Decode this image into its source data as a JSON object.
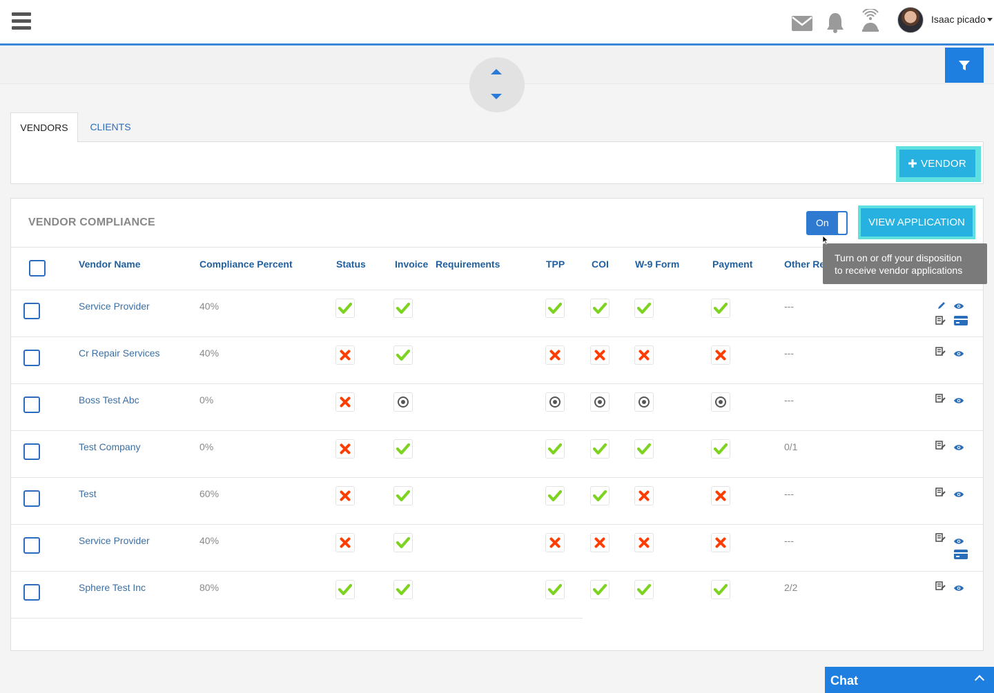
{
  "header": {
    "user_name": "Isaac picado",
    "icons": [
      "menu-icon",
      "mail-icon",
      "bell-icon",
      "broadcast-icon"
    ]
  },
  "tabs": [
    {
      "label": "VENDORS",
      "active": true
    },
    {
      "label": "CLIENTS",
      "active": false
    }
  ],
  "vendor_panel": {
    "add_button_label": "VENDOR"
  },
  "compliance": {
    "title": "VENDOR COMPLIANCE",
    "toggle_label": "On",
    "view_application_label": "VIEW APPLICATION",
    "tooltip_line1": "Turn on or off your disposition",
    "tooltip_line2": "to receive vendor applications",
    "columns": {
      "vendor_name": "Vendor Name",
      "compliance_percent": "Compliance Percent",
      "status": "Status",
      "invoice": "Invoice",
      "requirements": "Requirements",
      "tpp": "TPP",
      "coi": "COI",
      "w9": "W-9 Form",
      "payment": "Payment",
      "other": "Other Re"
    },
    "rows": [
      {
        "name": "Service Provider",
        "percent": "40%",
        "status": "check",
        "invoice": "check",
        "tpp": "check",
        "coi": "check",
        "w9": "check",
        "payment": "check",
        "other": "---"
      },
      {
        "name": "Cr Repair Services",
        "percent": "40%",
        "status": "cross",
        "invoice": "check",
        "tpp": "cross",
        "coi": "cross",
        "w9": "cross",
        "payment": "cross",
        "other": "---"
      },
      {
        "name": "Boss Test Abc",
        "percent": "0%",
        "status": "cross",
        "invoice": "pending",
        "tpp": "pending",
        "coi": "pending",
        "w9": "pending",
        "payment": "pending",
        "other": "---"
      },
      {
        "name": "Test Company",
        "percent": "0%",
        "status": "cross",
        "invoice": "check",
        "tpp": "check",
        "coi": "check",
        "w9": "check",
        "payment": "check",
        "other": "0/1"
      },
      {
        "name": "Test",
        "percent": "60%",
        "status": "cross",
        "invoice": "check",
        "tpp": "check",
        "coi": "check",
        "w9": "cross",
        "payment": "cross",
        "other": "---"
      },
      {
        "name": "Service Provider",
        "percent": "40%",
        "status": "cross",
        "invoice": "check",
        "tpp": "cross",
        "coi": "cross",
        "w9": "cross",
        "payment": "cross",
        "other": "---"
      },
      {
        "name": "Sphere Test Inc",
        "percent": "80%",
        "status": "check",
        "invoice": "check",
        "tpp": "check",
        "coi": "check",
        "w9": "check",
        "payment": "check",
        "other": "2/2"
      }
    ]
  },
  "chat": {
    "label": "Chat"
  },
  "colors": {
    "accent": "#1f7fe0",
    "check": "#7ed321",
    "cross": "#ff3d00",
    "link": "#3b6fa3",
    "cyan_button": "#26b1e0"
  }
}
